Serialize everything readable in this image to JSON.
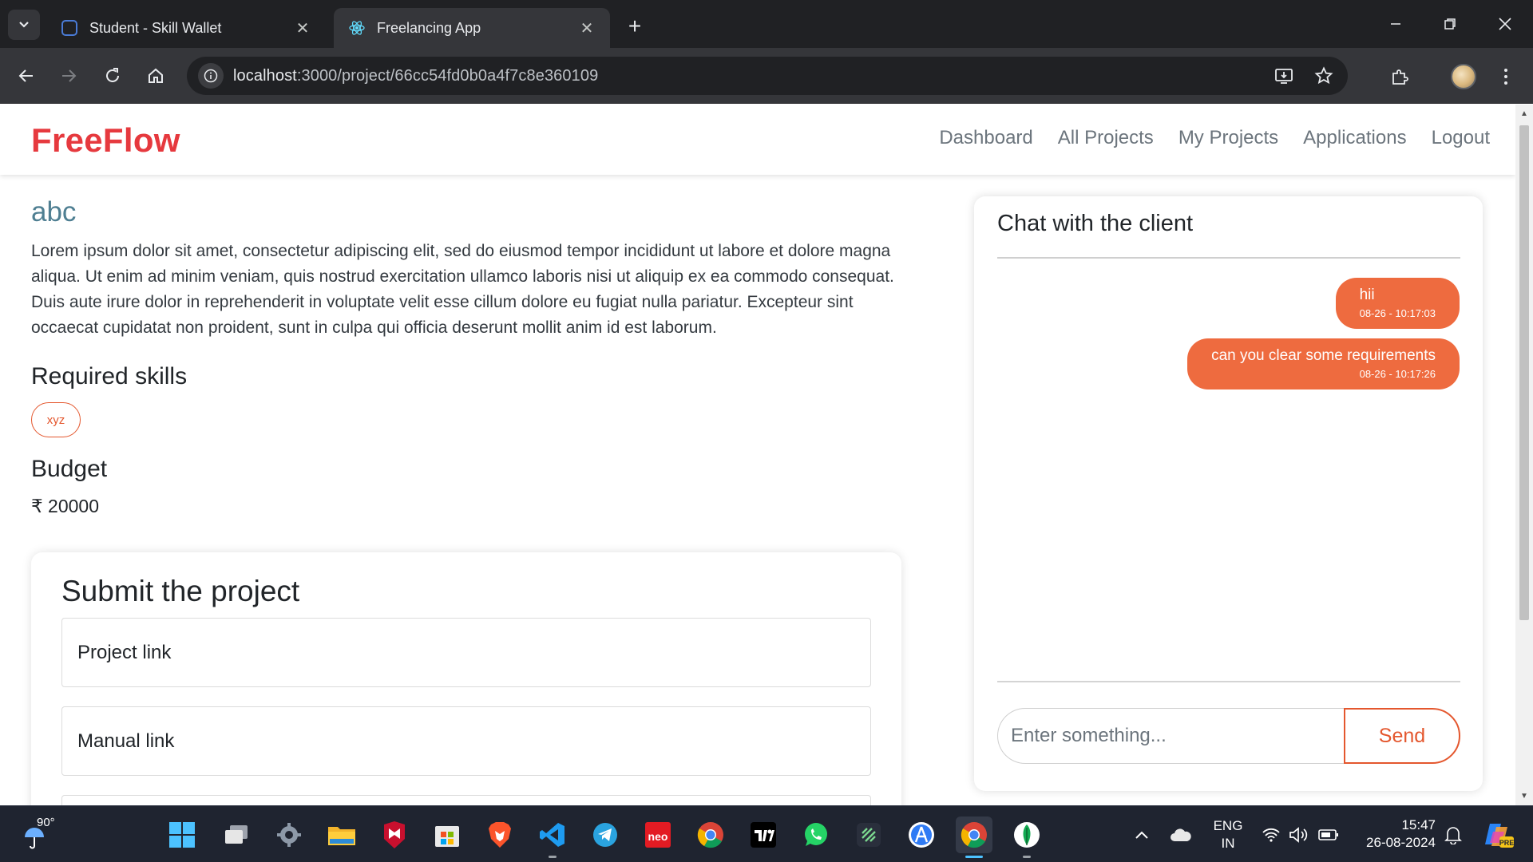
{
  "browser": {
    "tabs": [
      {
        "title": "Student - Skill Wallet",
        "active": false
      },
      {
        "title": "Freelancing App",
        "active": true
      }
    ],
    "url_host": "localhost",
    "url_path": ":3000/project/66cc54fd0b0a4f7c8e360109"
  },
  "app": {
    "brand": "FreeFlow",
    "nav": [
      "Dashboard",
      "All Projects",
      "My Projects",
      "Applications",
      "Logout"
    ],
    "brand_color": "#e6393e",
    "accent_color": "#ee6b3f"
  },
  "project": {
    "title": "abc",
    "description": "Lorem ipsum dolor sit amet, consectetur adipiscing elit, sed do eiusmod tempor incididunt ut labore et dolore magna aliqua. Ut enim ad minim veniam, quis nostrud exercitation ullamco laboris nisi ut aliquip ex ea commodo consequat. Duis aute irure dolor in reprehenderit in voluptate velit esse cillum dolore eu fugiat nulla pariatur. Excepteur sint occaecat cupidatat non proident, sunt in culpa qui officia deserunt mollit anim id est laborum.",
    "skills_heading": "Required skills",
    "skills": [
      "xyz"
    ],
    "budget_heading": "Budget",
    "budget": "₹ 20000"
  },
  "submit": {
    "title": "Submit the project",
    "project_link_placeholder": "Project link",
    "manual_link_placeholder": "Manual link"
  },
  "chat": {
    "title": "Chat with the client",
    "messages": [
      {
        "text": "hii",
        "time": "08-26 - 10:17:03"
      },
      {
        "text": "can you clear some requirements",
        "time": "08-26 - 10:17:26"
      }
    ],
    "input_placeholder": "Enter something...",
    "send_label": "Send"
  },
  "taskbar": {
    "weather_temp": "90°",
    "lang_line1": "ENG",
    "lang_line2": "IN",
    "time": "15:47",
    "date": "26-08-2024"
  }
}
